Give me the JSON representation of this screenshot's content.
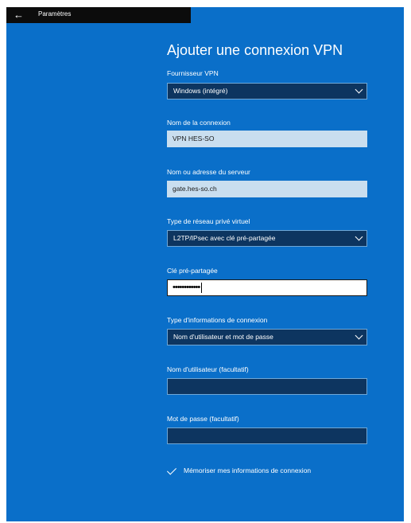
{
  "titlebar": {
    "back_glyph": "←",
    "title": "Paramètres"
  },
  "page": {
    "title": "Ajouter une connexion VPN"
  },
  "provider": {
    "label": "Fournisseur VPN",
    "value": "Windows (intégré)"
  },
  "connection_name": {
    "label": "Nom de la connexion",
    "value": "VPN HES-SO"
  },
  "server": {
    "label": "Nom ou adresse du serveur",
    "value": "gate.hes-so.ch"
  },
  "vpn_type": {
    "label": "Type de réseau privé virtuel",
    "value": "L2TP/IPsec avec clé pré-partagée"
  },
  "psk": {
    "label": "Clé pré-partagée",
    "value": "••••••••••••"
  },
  "signin_type": {
    "label": "Type d'informations de connexion",
    "value": "Nom d'utilisateur et mot de passe"
  },
  "username": {
    "label": "Nom d'utilisateur (facultatif)",
    "value": ""
  },
  "password": {
    "label": "Mot de passe (facultatif)",
    "value": ""
  },
  "remember": {
    "label": "Mémoriser mes informations de connexion",
    "checked": true
  },
  "colors": {
    "accent": "#0a6fc9",
    "field_dark": "#0d3560",
    "field_light": "#c9deef"
  }
}
